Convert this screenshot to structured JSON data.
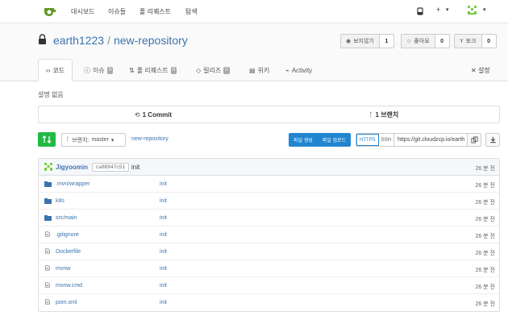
{
  "nav": {
    "items": [
      "대시보드",
      "이슈들",
      "풀 리퀘스트",
      "탐색"
    ],
    "plus": "+"
  },
  "repo": {
    "owner": "earth1223",
    "separator": "/",
    "name": "new-repository",
    "watch": {
      "label": "보지않기",
      "count": "1"
    },
    "star": {
      "label": "좋아요",
      "count": "0"
    },
    "fork": {
      "label": "포크",
      "count": "0"
    }
  },
  "tabs": [
    {
      "label": "코드",
      "icon": "code-icon",
      "badge": ""
    },
    {
      "label": "이슈",
      "icon": "issue-icon",
      "badge": "0"
    },
    {
      "label": "풀 리퀘스트",
      "icon": "pull-request-icon",
      "badge": "0"
    },
    {
      "label": "릴리즈",
      "icon": "tag-icon",
      "badge": "0"
    },
    {
      "label": "위키",
      "icon": "book-icon",
      "badge": ""
    },
    {
      "label": "Activity",
      "icon": "pulse-icon",
      "badge": ""
    }
  ],
  "settings_label": "설정",
  "description": "설명 없음",
  "stats": {
    "commits": "1 Commit",
    "branches": "1 브랜치"
  },
  "branch": {
    "label": "브랜치:",
    "value": "master"
  },
  "breadcrumb": "new-repository",
  "file_actions": {
    "new_file": "파일 생성",
    "upload": "파일 업로드"
  },
  "clone": {
    "https": "HTTPS",
    "ssh": "SSH",
    "url": "https://git.cloudzcp.io/earth"
  },
  "latest_commit": {
    "user": "Jigyoomin",
    "sha": "ca88947c51",
    "message": "init",
    "time": "26 분 전"
  },
  "files": [
    {
      "name": ".mvn/wrapper",
      "type": "folder",
      "message": "init",
      "time": "26 분 전"
    },
    {
      "name": "k8s",
      "type": "folder",
      "message": "init",
      "time": "26 분 전"
    },
    {
      "name": "src/main",
      "type": "folder",
      "message": "init",
      "time": "26 분 전"
    },
    {
      "name": ".gitignore",
      "type": "file",
      "message": "init",
      "time": "26 분 전"
    },
    {
      "name": "Dockerfile",
      "type": "file",
      "message": "init",
      "time": "26 분 전"
    },
    {
      "name": "mvnw",
      "type": "file",
      "message": "init",
      "time": "26 분 전"
    },
    {
      "name": "mvnw.cmd",
      "type": "file",
      "message": "init",
      "time": "26 분 전"
    },
    {
      "name": "pom.xml",
      "type": "file",
      "message": "init",
      "time": "26 분 전"
    }
  ],
  "colors": {
    "link": "#3b73af",
    "green": "#21ba45",
    "blue": "#2185d0"
  }
}
